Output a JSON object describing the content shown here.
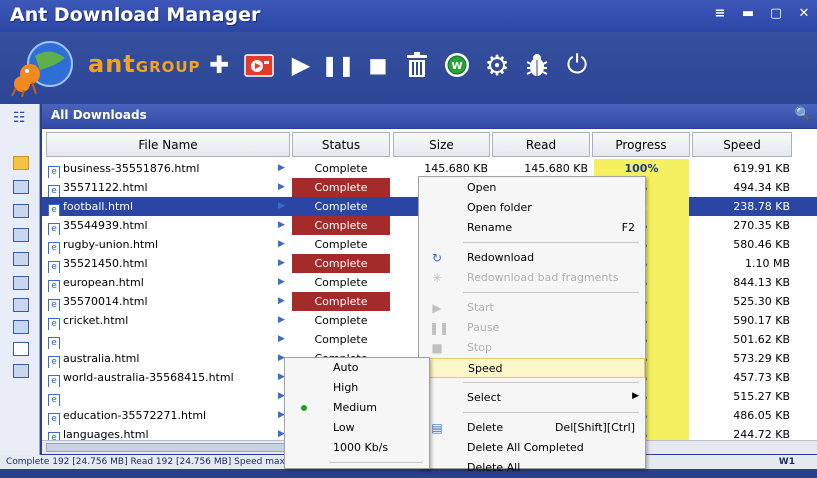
{
  "window": {
    "title": "Ant Download Manager",
    "controls": [
      "≡",
      "▬",
      "▢",
      "✕"
    ]
  },
  "brand": {
    "name": "ant",
    "suffix": "GROUP"
  },
  "toolbar": {
    "buttons": [
      "add-icon",
      "video-icon",
      "play-icon",
      "pause-icon",
      "stop-icon",
      "delete-icon",
      "update-icon",
      "settings-icon",
      "bug-icon",
      "power-icon"
    ]
  },
  "panel": {
    "title": "All Downloads"
  },
  "columns": [
    "File Name",
    "Status",
    "Size",
    "Read",
    "Progress",
    "Speed"
  ],
  "rows": [
    {
      "name": "business-35551876.html",
      "status": "Complete",
      "status_error": false,
      "size": "145.680 KB",
      "read": "145.680 KB",
      "progress": "100%",
      "speed": "619.91 KB"
    },
    {
      "name": "35571122.html",
      "status": "Complete",
      "status_error": true,
      "size": "",
      "read": "",
      "progress": "%",
      "speed": "494.34 KB"
    },
    {
      "name": "football.html",
      "status": "Complete",
      "status_error": false,
      "size": "",
      "read": "",
      "progress": "%",
      "speed": "238.78 KB",
      "selected": true
    },
    {
      "name": "35544939.html",
      "status": "Complete",
      "status_error": true,
      "size": "",
      "read": "",
      "progress": "%",
      "speed": "270.35 KB"
    },
    {
      "name": "rugby-union.html",
      "status": "Complete",
      "status_error": false,
      "size": "",
      "read": "",
      "progress": "%",
      "speed": "580.46 KB"
    },
    {
      "name": "35521450.html",
      "status": "Complete",
      "status_error": true,
      "size": "",
      "read": "",
      "progress": "%",
      "speed": "1.10 MB"
    },
    {
      "name": "european.html",
      "status": "Complete",
      "status_error": false,
      "size": "",
      "read": "",
      "progress": "%",
      "speed": "844.13 KB"
    },
    {
      "name": "35570014.html",
      "status": "Complete",
      "status_error": true,
      "size": "",
      "read": "",
      "progress": "%",
      "speed": "525.30 KB"
    },
    {
      "name": "cricket.html",
      "status": "Complete",
      "status_error": false,
      "size": "",
      "read": "",
      "progress": "%",
      "speed": "590.17 KB"
    },
    {
      "name": "",
      "status": "Complete",
      "status_error": false,
      "size": "",
      "read": "",
      "progress": "%",
      "speed": "501.62 KB"
    },
    {
      "name": "australia.html",
      "status": "Complete",
      "status_error": false,
      "size": "",
      "read": "",
      "progress": "%",
      "speed": "573.29 KB"
    },
    {
      "name": "world-australia-35568415.html",
      "status": "",
      "status_error": false,
      "size": "",
      "read": "",
      "progress": "%",
      "speed": "457.73 KB"
    },
    {
      "name": "",
      "status": "",
      "status_error": false,
      "size": "",
      "read": "",
      "progress": "%",
      "speed": "515.27 KB"
    },
    {
      "name": "education-35572271.html",
      "status": "",
      "status_error": false,
      "size": "",
      "read": "",
      "progress": "%",
      "speed": "486.05 KB"
    },
    {
      "name": "languages.html",
      "status": "",
      "status_error": false,
      "size": "",
      "read": "",
      "progress": "%",
      "speed": "244.72 KB"
    }
  ],
  "context_menu": {
    "open": "Open",
    "open_folder": "Open folder",
    "rename": "Rename",
    "rename_sc": "F2",
    "redownload": "Redownload",
    "redownload_bad": "Redownload bad fragments",
    "start": "Start",
    "pause": "Pause",
    "stop": "Stop",
    "speed": "Speed",
    "select": "Select",
    "delete": "Delete",
    "delete_sc": "Del[Shift][Ctrl]",
    "delete_all_completed": "Delete All Completed",
    "delete_all": "Delete All"
  },
  "speed_menu": {
    "items": [
      "Auto",
      "High",
      "Medium",
      "Low",
      "1000 Kb/s"
    ],
    "selected": "Medium"
  },
  "statusbar": {
    "text": "Complete 192 [24.756 MB]  Read 192 [24.756 MB]  Speed max 1.2",
    "w1": "W1"
  },
  "colors": {
    "accent": "#2c46a6",
    "error": "#a52a2a",
    "progress": "#f5f060",
    "selection": "#2a45a3"
  }
}
